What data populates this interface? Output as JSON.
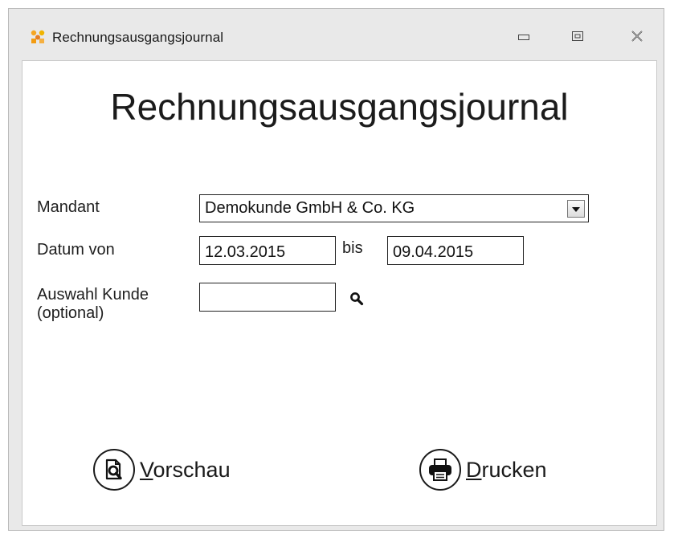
{
  "window": {
    "title": "Rechnungsausgangsjournal",
    "icon": "app-icon",
    "controls": [
      "minimize-icon",
      "restore-icon",
      "close-icon"
    ]
  },
  "form": {
    "heading": "Rechnungsausgangsjournal",
    "mandant_label": "Mandant",
    "mandant_value": "Demokunde GmbH & Co. KG",
    "datum_von_label": "Datum von",
    "datum_von_value": "12.03.2015",
    "bis_label": "bis",
    "datum_bis_value": "09.04.2015",
    "kunde_label_line1": "Auswahl Kunde",
    "kunde_label_line2": "(optional)",
    "kunde_value": ""
  },
  "actions": {
    "preview_mnemonic": "V",
    "preview_rest": "orschau",
    "print_mnemonic": "D",
    "print_rest": "rucken"
  },
  "colors": {
    "window_bg": "#e9e9e9",
    "client_bg": "#ffffff",
    "icon_orange": "#f5a623"
  }
}
